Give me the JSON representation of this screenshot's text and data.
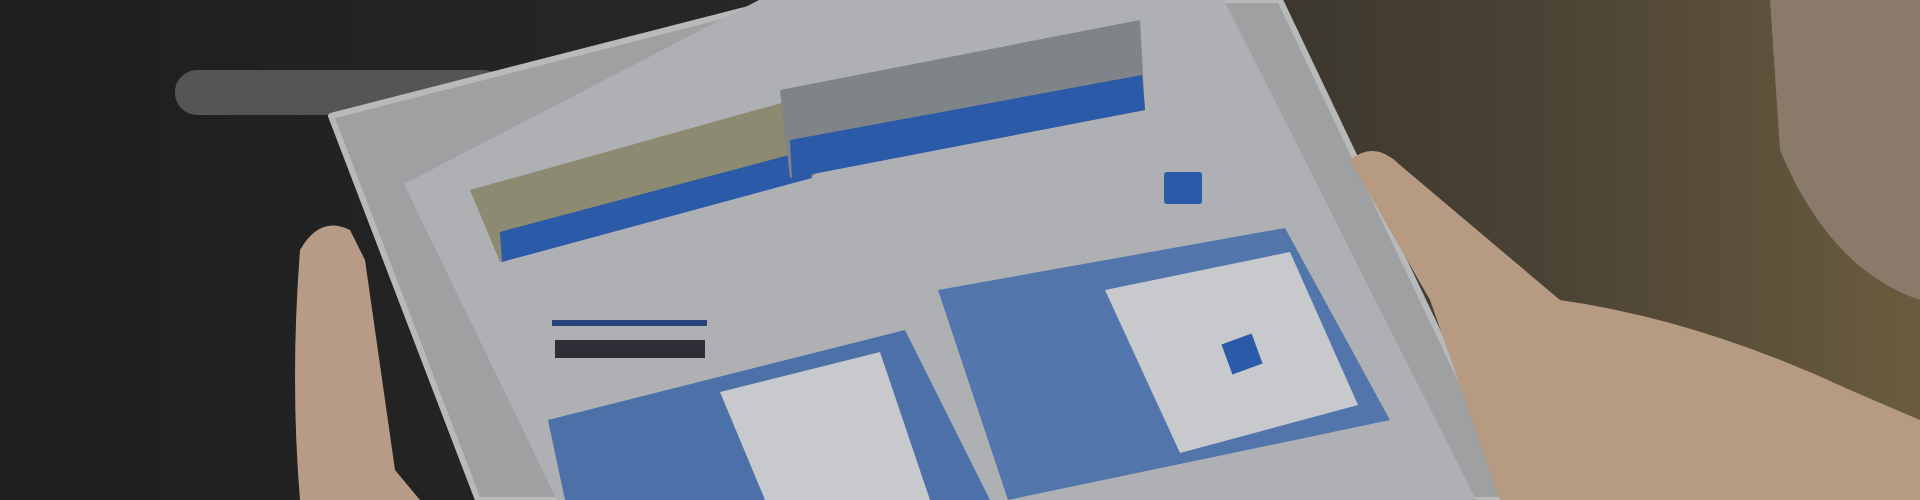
{
  "scene": {
    "kind": "tablet-photo"
  }
}
